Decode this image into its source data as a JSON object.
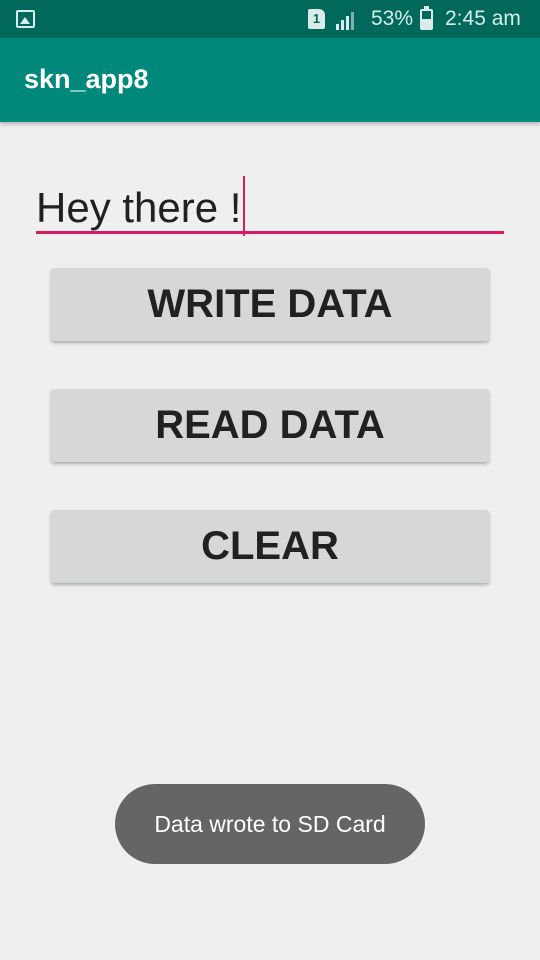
{
  "status_bar": {
    "sim_label": "1",
    "battery_percent": "53%",
    "time": "2:45 am",
    "icons": [
      "gallery-icon",
      "sim-icon",
      "signal-icon",
      "battery-charging-icon"
    ]
  },
  "app_bar": {
    "title": "skn_app8",
    "color": "#00897b"
  },
  "text_field": {
    "value": "Hey there !",
    "underline_color": "#d81b60"
  },
  "buttons": {
    "write_label": "WRITE DATA",
    "read_label": "READ DATA",
    "clear_label": "CLEAR"
  },
  "toast": {
    "message": "Data wrote to SD Card"
  }
}
